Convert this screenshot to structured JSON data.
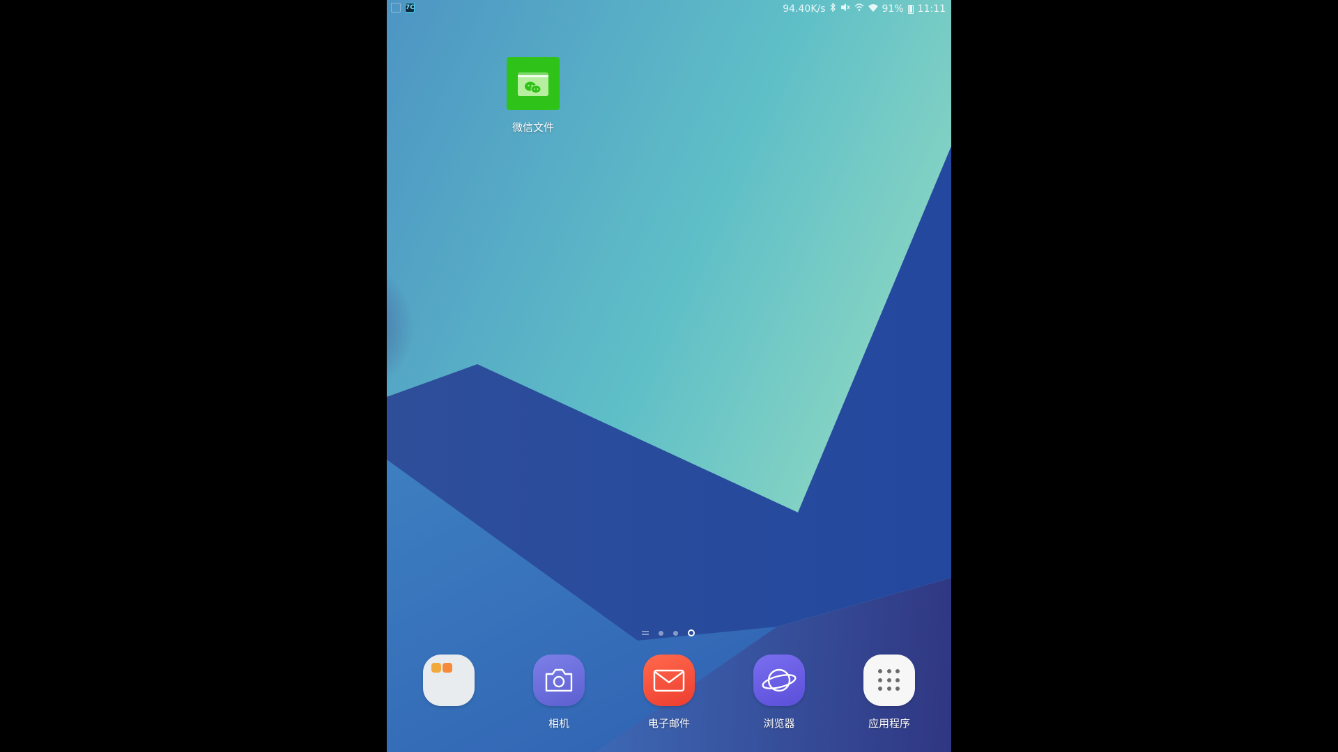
{
  "status_bar": {
    "net_speed": "94.40K/s",
    "battery": "91%",
    "time": "11:11",
    "notification_icons": [
      "frame-icon",
      "app-icon"
    ],
    "system_icons": [
      "bluetooth-icon",
      "mute-icon",
      "hotspot-icon",
      "wifi-icon",
      "battery-icon"
    ]
  },
  "desktop": {
    "shortcuts": [
      {
        "label": "微信文件",
        "icon": "wechat-folder-icon",
        "color": "#2fc218"
      }
    ]
  },
  "page_indicator": {
    "pages": 4,
    "current_page": 4
  },
  "dock": {
    "items": [
      {
        "label": "",
        "icon": "folder-icon"
      },
      {
        "label": "相机",
        "icon": "camera-icon",
        "color": "#6b6ee0"
      },
      {
        "label": "电子邮件",
        "icon": "email-icon",
        "color": "#f24b36"
      },
      {
        "label": "浏览器",
        "icon": "browser-icon",
        "color": "#6a5fe6"
      },
      {
        "label": "应用程序",
        "icon": "apps-grid-icon"
      }
    ]
  }
}
